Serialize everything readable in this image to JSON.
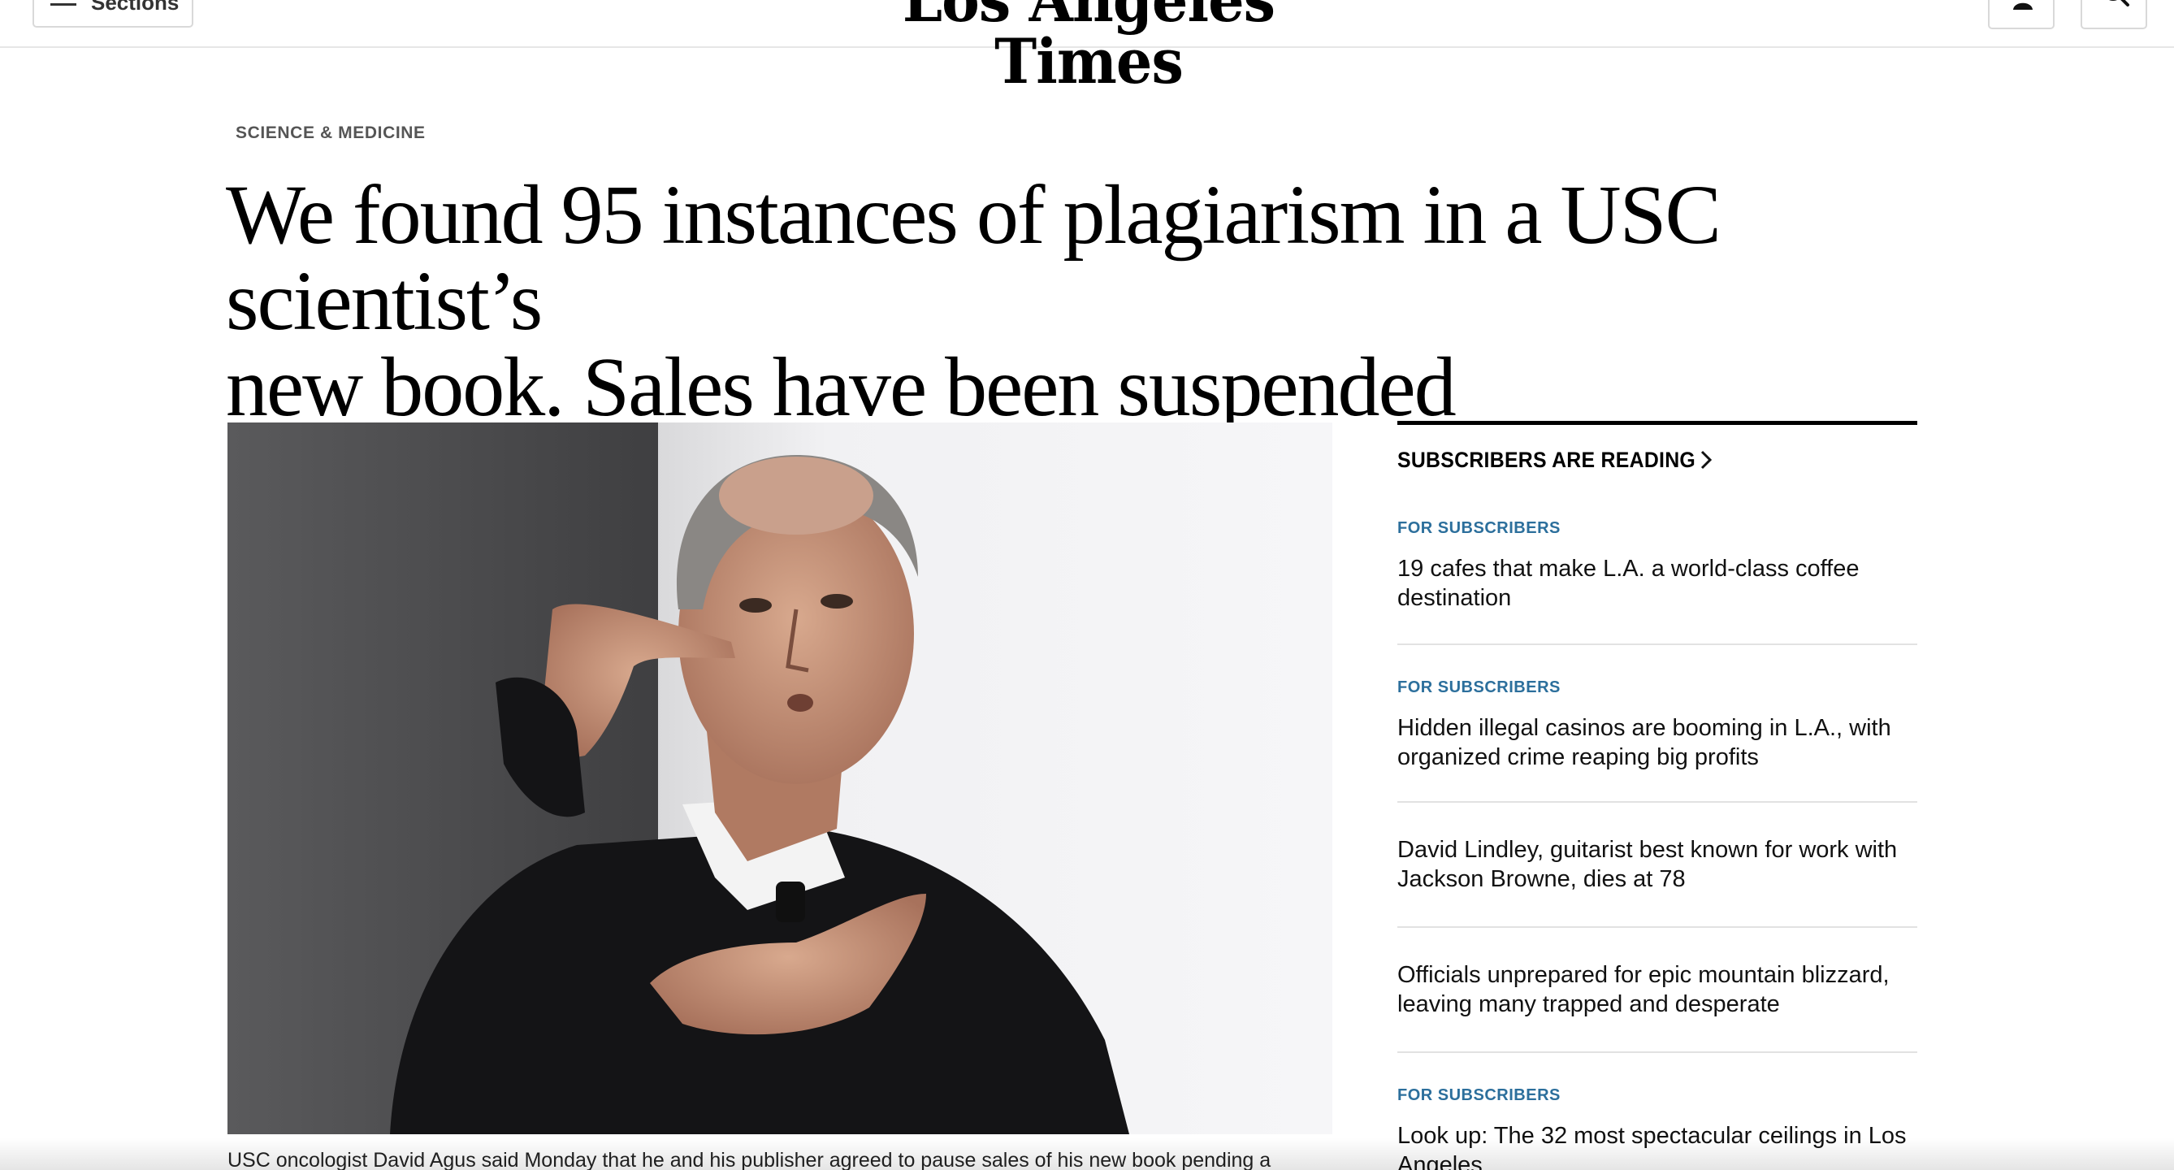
{
  "header": {
    "sections_label": "Sections",
    "masthead": "Los Angeles Times"
  },
  "article": {
    "kicker": "SCIENCE & MEDICINE",
    "headline_line1": "We found 95 instances of plagiarism in a USC scientist’s",
    "headline_line2": "new book. Sales have been suspended",
    "caption": "USC oncologist David Agus said Monday that he and his publisher agreed to pause sales of his new book pending a"
  },
  "rail": {
    "title": "SUBSCRIBERS ARE READING",
    "items": [
      {
        "badge": "FOR SUBSCRIBERS",
        "title_line1": "19 cafes that make L.A. a world-class coffee",
        "title_line2": "destination"
      },
      {
        "badge": "FOR SUBSCRIBERS",
        "title_line1": "Hidden illegal casinos are booming in L.A., with",
        "title_line2": "organized crime reaping big profits"
      },
      {
        "badge": "",
        "title_line1": "David Lindley, guitarist best known for work with",
        "title_line2": "Jackson Browne, dies at 78"
      },
      {
        "badge": "",
        "title_line1": "Officials unprepared for epic mountain blizzard,",
        "title_line2": "leaving many trapped and desperate"
      },
      {
        "badge": "FOR SUBSCRIBERS",
        "title_line1": "Look up: The 32 most spectacular ceilings in Los",
        "title_line2": "Angeles"
      }
    ]
  },
  "colors": {
    "subscriber_badge": "#2c6f9c",
    "text": "#111111",
    "divider": "#e2e2e2"
  },
  "icons": [
    "hamburger-icon",
    "account-icon",
    "search-icon",
    "chevron-right-icon"
  ]
}
